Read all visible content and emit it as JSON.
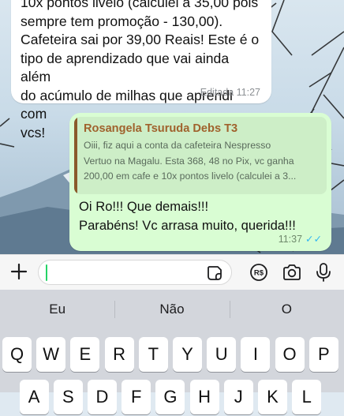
{
  "chat": {
    "incoming": {
      "text": "10x pontos livelo (calculei a 35,00 pois\nsempre tem promoção - 130,00).\nCafeteira sai por 39,00 Reais! Este é o\ntipo de aprendizado que vai ainda além\ndo acúmulo de milhas que aprendi com\nvcs!",
      "edited_label": "Editada 11:27"
    },
    "outgoing": {
      "quote_author": "Rosangela Tsuruda Debs T3",
      "quote_text": "Oiii, fiz aqui a conta da cafeteira Nespresso\nVertuo na Magalu. Esta 368, 48 no Pix, vc ganha\n200,00 em cafe e 10x pontos livelo (calculei a 3...",
      "text": "Oi Ro!!! Que demais!!!\nParabéns! Vc arrasa muito, querida!!!",
      "time": "11:37",
      "ticks": "✓✓"
    }
  },
  "input_bar": {
    "message_value": "",
    "icons": [
      "plus-icon",
      "sticker-icon",
      "pix-payment-icon",
      "camera-icon",
      "microphone-icon"
    ]
  },
  "keyboard": {
    "suggestions": [
      "Eu",
      "Não",
      "O"
    ],
    "row1": [
      "Q",
      "W",
      "E",
      "R",
      "T",
      "Y",
      "U",
      "I",
      "O",
      "P"
    ],
    "row2": [
      "A",
      "S",
      "D",
      "F",
      "G",
      "H",
      "J",
      "K",
      "L"
    ]
  },
  "colors": {
    "accent_green": "#25d366",
    "outgoing_bubble": "#d9fdd3",
    "quote_author": "#a0622d",
    "read_ticks": "#34b7f1"
  }
}
